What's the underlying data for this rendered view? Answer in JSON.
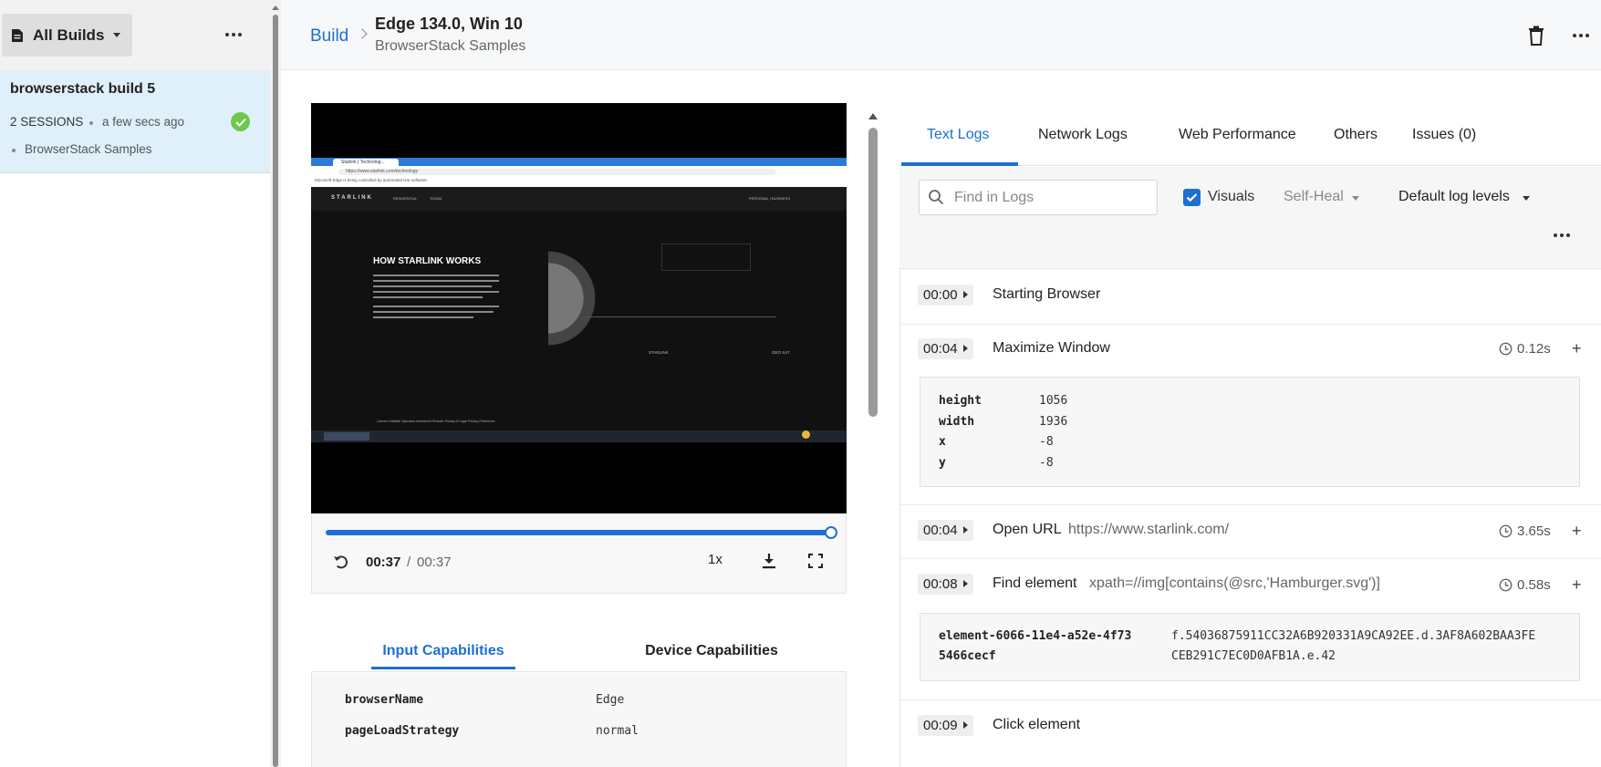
{
  "sidebar": {
    "all_builds_label": "All Builds",
    "build": {
      "title": "browserstack build 5",
      "sessions": "2 SESSIONS",
      "time": "a few secs ago",
      "project": "BrowserStack Samples",
      "status": "passed"
    }
  },
  "header": {
    "breadcrumb_build": "Build",
    "session_title": "Edge 134.0, Win 10",
    "session_subtitle": "BrowserStack Samples"
  },
  "video": {
    "progress_fraction": 1.0,
    "time_current": "00:37",
    "time_separator": "/",
    "time_total": "00:37",
    "speed": "1x",
    "recording": {
      "tab_title": "Starlink | Technolog...",
      "address": "https://www.starlink.com/technology",
      "automation_notice": "Microsoft Edge is being controlled by automated test software.",
      "logo": "STARLINK",
      "nav_residential": "RESIDENTIAL",
      "nav_roam": "ROAM",
      "nav_right": "PERSONAL | BUSINESS",
      "headline": "HOW STARLINK WORKS",
      "label_starlink": "STARLINK",
      "label_geosat": "GEO SAT",
      "footer": "Careers   Satellite Operators   Authorized Reseller   Privacy & Legal   Privacy Preference",
      "taskbar_app": "Starlink | Technolog..."
    }
  },
  "capabilities": {
    "tab_input": "Input Capabilities",
    "tab_device": "Device Capabilities",
    "rows": [
      {
        "key": "browserName",
        "value": "Edge"
      },
      {
        "key": "pageLoadStrategy",
        "value": "normal"
      }
    ]
  },
  "logs": {
    "tabs": {
      "text_logs": "Text Logs",
      "network_logs": "Network Logs",
      "web_performance": "Web Performance",
      "others": "Others",
      "issues": "Issues (0)"
    },
    "toolbar": {
      "find_placeholder": "Find in Logs",
      "visuals_label": "Visuals",
      "visuals_checked": true,
      "self_heal_label": "Self-Heal",
      "log_levels_label": "Default log levels"
    },
    "entries": [
      {
        "time": "00:00",
        "name": "Starting Browser"
      },
      {
        "time": "00:04",
        "name": "Maximize Window",
        "duration": "0.12s",
        "details": [
          {
            "key": "height",
            "value": "1056"
          },
          {
            "key": "width",
            "value": "1936"
          },
          {
            "key": "x",
            "value": "-8"
          },
          {
            "key": "y",
            "value": "-8"
          }
        ]
      },
      {
        "time": "00:04",
        "name": "Open URL",
        "arg": "https://www.starlink.com/",
        "duration": "3.65s"
      },
      {
        "time": "00:08",
        "name": "Find element",
        "arg": "xpath=//img[contains(@src,'Hamburger.svg')]",
        "duration": "0.58s",
        "details": [
          {
            "key_line1": "element-6066-11e4-a52e-4f73",
            "key_line2": "5466cecf",
            "value_line1": "f.54036875911CC32A6B920331A9CA92EE.d.3AF8A602BAA3FE",
            "value_line2": "CEB291C7EC0D0AFB1A.e.42"
          }
        ]
      },
      {
        "time": "00:09",
        "name": "Click element"
      }
    ]
  },
  "colors": {
    "accent": "#1d6fd1",
    "success": "#6cc84b",
    "selected_row": "#dff0fb"
  }
}
